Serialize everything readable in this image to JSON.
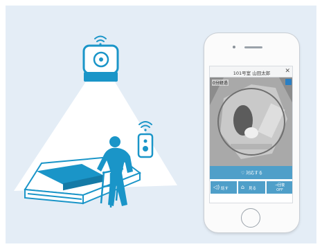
{
  "scene": {
    "sensor": {
      "name": "ceiling sensor"
    },
    "bed_sensor": {
      "name": "bed-side sensor"
    }
  },
  "app": {
    "header_title": "101号室 山田太郎",
    "close_glyph": "✕",
    "elapsed_text": "0分経過",
    "respond_label": "対応する",
    "buttons": {
      "speak_label": "話す",
      "watch_label": "見る",
      "off_top": "→回復",
      "off_bottom": "OFF"
    }
  },
  "colors": {
    "background_panel": "#e4edf6",
    "accent_blue": "#1a95c8",
    "button_blue": "#4f9fc9"
  }
}
